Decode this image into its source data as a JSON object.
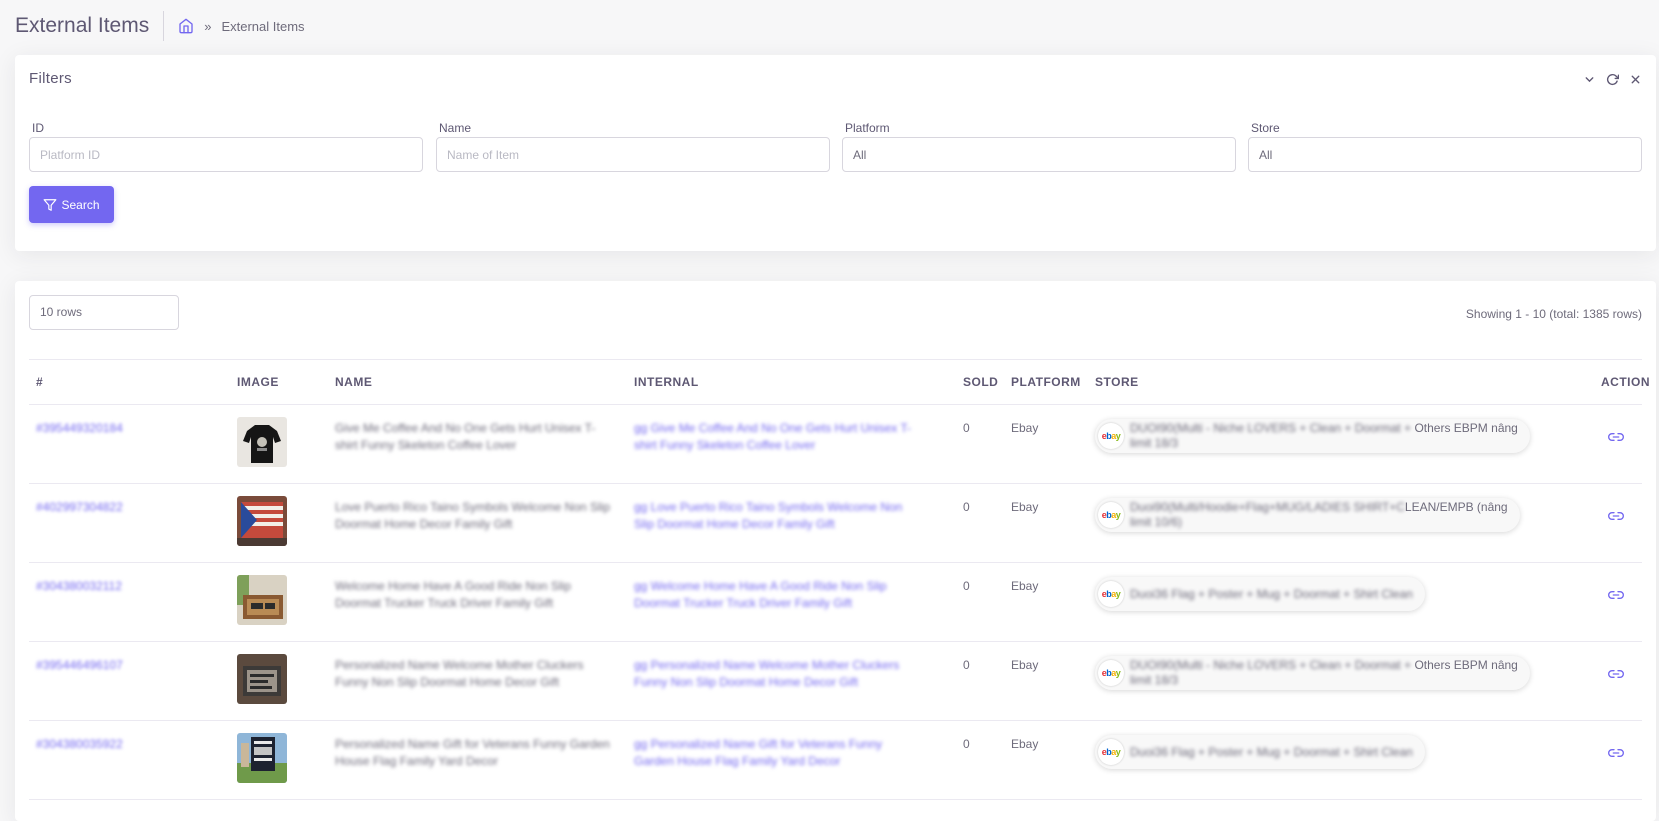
{
  "header": {
    "title": "External Items",
    "breadcrumb_current": "External Items",
    "breadcrumb_sep": "»"
  },
  "filters": {
    "title": "Filters",
    "id_label": "ID",
    "id_placeholder": "Platform ID",
    "name_label": "Name",
    "name_placeholder": "Name of Item",
    "platform_label": "Platform",
    "platform_value": "All",
    "store_label": "Store",
    "store_value": "All",
    "search_label": "Search"
  },
  "table": {
    "rows_select": "10 rows",
    "showing": "Showing 1 - 10 (total: 1385 rows)",
    "headers": {
      "id": "#",
      "image": "IMAGE",
      "name": "NAME",
      "internal": "INTERNAL",
      "sold": "SOLD",
      "platform": "PLATFORM",
      "store": "STORE",
      "action": "ACTION"
    },
    "rows": [
      {
        "id": "#395449320184",
        "name": "Give Me Coffee And No One Gets Hurt Unisex T-shirt Funny Skeleton Coffee Lover",
        "internal": "gg Give Me Coffee And No One Gets Hurt Unisex T-shirt Funny Skeleton Coffee Lover",
        "sold": "0",
        "platform": "Ebay",
        "store_blur": "DUOI90(Multi - Niche LOVERS + Clean + Doormat +",
        "store_clear": "Others EBPM nâng",
        "store_line2": "limit 18/3"
      },
      {
        "id": "#402997304822",
        "name": "Love Puerto Rico Taino Symbols Welcome Non Slip Doormat Home Decor Family Gift",
        "internal": "gg Love Puerto Rico Taino Symbols Welcome Non Slip Doormat Home Decor Family Gift",
        "sold": "0",
        "platform": "Ebay",
        "store_blur": "Duoi90(Multi/Hoodie+Flag+MUG/LADIES SHIRT+C",
        "store_clear": "LEAN/EMPB (nâng",
        "store_line2": "limit 10/6)"
      },
      {
        "id": "#304380032112",
        "name": "Welcome Home Have A Good Ride Non Slip Doormat Trucker Truck Driver Family Gift",
        "internal": "gg Welcome Home Have A Good Ride Non Slip Doormat Trucker Truck Driver Family Gift",
        "sold": "0",
        "platform": "Ebay",
        "store_blur": "Duoi36 Flag + Poster + Mug + Doormat + Shirt Clean",
        "store_clear": "",
        "store_line2": ""
      },
      {
        "id": "#395446496107",
        "name": "Personalized Name Welcome Mother Cluckers Funny Non Slip Doormat Home Decor Gift",
        "internal": "gg Personalized Name Welcome Mother Cluckers Funny Non Slip Doormat Home Decor Gift",
        "sold": "0",
        "platform": "Ebay",
        "store_blur": "DUOI90(Multi - Niche LOVERS + Clean + Doormat +",
        "store_clear": "Others EBPM nâng",
        "store_line2": "limit 18/3"
      },
      {
        "id": "#304380035922",
        "name": "Personalized Name Gift for Veterans Funny Garden House Flag Family Yard Decor",
        "internal": "gg Personalized Name Gift for Veterans Funny Garden House Flag Family Yard Decor",
        "sold": "0",
        "platform": "Ebay",
        "store_blur": "Duoi36 Flag + Poster + Mug + Doormat + Shirt Clean",
        "store_clear": "",
        "store_line2": ""
      }
    ]
  },
  "colors": {
    "primary": "#7367f0",
    "text": "#5e5873",
    "muted": "#6e6b7b",
    "border": "#d8d6de"
  },
  "icons": [
    "home-icon",
    "chevron-down-icon",
    "refresh-icon",
    "close-icon",
    "filter-icon",
    "link-icon"
  ]
}
